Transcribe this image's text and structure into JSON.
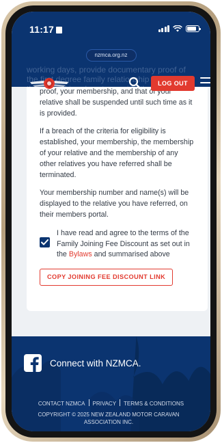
{
  "status_bar": {
    "time": "11:17"
  },
  "url": "nzmca.org.nz",
  "header": {
    "ghost_text": "working days, provide documentary proof of the first degree family relationship no longer than 5 working days to provide the",
    "logout_label": "LOG OUT"
  },
  "content": {
    "paragraph_1": "proof, your membership, and that of your relative shall be suspended until such time as it is provided.",
    "paragraph_2": "If a breach of the criteria for eligibility is established, your membership, the membership of your relative and the membership of any other relatives you have referred shall be terminated.",
    "paragraph_3": "Your membership number and name(s) will be displayed to the relative you have referred, on their members portal.",
    "agree_before": "I have read and agree to the terms of the Family Joining Fee Discount as set out in the ",
    "agree_link": "Bylaws",
    "agree_after": " and summarised above",
    "agree_checked": true,
    "copy_button": "COPY JOINING FEE DISCOUNT LINK"
  },
  "footer": {
    "social_text": "Connect with NZMCA.",
    "links": [
      "CONTACT NZMCA",
      "PRIVACY",
      "TERMS & CONDITIONS"
    ],
    "copyright": "COPYRIGHT © 2025 NEW ZEALAND MOTOR CARAVAN ASSOCIATION INC."
  },
  "colors": {
    "brand_navy": "#0b3470",
    "accent_red": "#e23a2f"
  }
}
